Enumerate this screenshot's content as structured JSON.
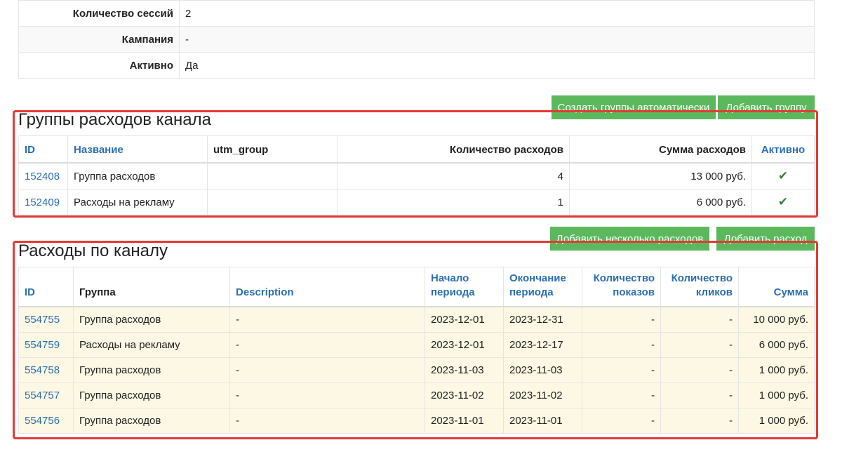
{
  "details": [
    {
      "label": "Количество сессий",
      "value": "2"
    },
    {
      "label": "Кампания",
      "value": "-"
    },
    {
      "label": "Активно",
      "value": "Да"
    }
  ],
  "groups_section": {
    "title": "Группы расходов канала",
    "buttons": [
      "Создать группы автоматически",
      "Добавить группу"
    ],
    "columns": [
      "ID",
      "Название",
      "utm_group",
      "Количество расходов",
      "Сумма расходов",
      "Активно"
    ],
    "rows": [
      {
        "id": "152408",
        "name": "Группа расходов",
        "utm_group": "",
        "count": "4",
        "sum": "13 000 руб.",
        "active": "✔"
      },
      {
        "id": "152409",
        "name": "Расходы на рекламу",
        "utm_group": "",
        "count": "1",
        "sum": "6 000 руб.",
        "active": "✔"
      }
    ]
  },
  "expenses_section": {
    "title": "Расходы по каналу",
    "buttons": [
      "Добавить несколько расходов",
      "Добавить расход"
    ],
    "columns": {
      "id": "ID",
      "group": "Группа",
      "description": "Description",
      "start_1": "Начало",
      "start_2": "периода",
      "end_1": "Окончание",
      "end_2": "периода",
      "impr_1": "Количество",
      "impr_2": "показов",
      "clicks_1": "Количество",
      "clicks_2": "кликов",
      "sum": "Сумма"
    },
    "rows": [
      {
        "id": "554755",
        "group": "Группа расходов",
        "description": "-",
        "start": "2023-12-01",
        "end": "2023-12-31",
        "impressions": "-",
        "clicks": "-",
        "sum": "10 000 руб."
      },
      {
        "id": "554759",
        "group": "Расходы на рекламу",
        "description": "-",
        "start": "2023-12-01",
        "end": "2023-12-17",
        "impressions": "-",
        "clicks": "-",
        "sum": "6 000 руб."
      },
      {
        "id": "554758",
        "group": "Группа расходов",
        "description": "-",
        "start": "2023-11-03",
        "end": "2023-11-03",
        "impressions": "-",
        "clicks": "-",
        "sum": "1 000 руб."
      },
      {
        "id": "554757",
        "group": "Группа расходов",
        "description": "-",
        "start": "2023-11-02",
        "end": "2023-11-02",
        "impressions": "-",
        "clicks": "-",
        "sum": "1 000 руб."
      },
      {
        "id": "554756",
        "group": "Группа расходов",
        "description": "-",
        "start": "2023-11-01",
        "end": "2023-11-01",
        "impressions": "-",
        "clicks": "-",
        "sum": "1 000 руб."
      }
    ]
  },
  "colors": {
    "primary_link": "#2a6fb0",
    "button_green": "#5cb85c",
    "highlight_red": "#e53935",
    "row_highlight": "#fcf8e3"
  }
}
